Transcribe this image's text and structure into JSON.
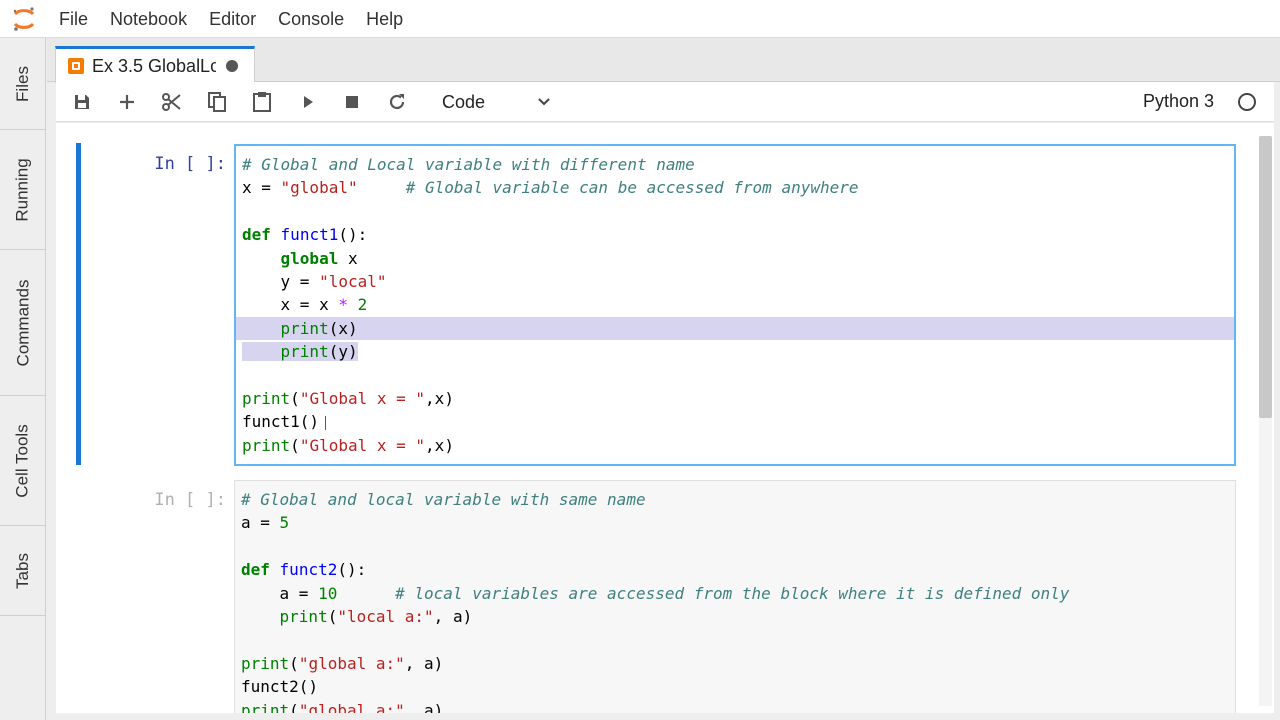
{
  "menu": {
    "items": [
      "File",
      "Notebook",
      "Editor",
      "Console",
      "Help"
    ]
  },
  "sidebar": {
    "tabs": [
      "Files",
      "Running",
      "Commands",
      "Cell Tools",
      "Tabs"
    ]
  },
  "document_tab": {
    "label": "Ex 3.5 GlobalLc"
  },
  "toolbar": {
    "cell_type": "Code",
    "kernel": "Python 3"
  },
  "cells": [
    {
      "prompt": "In [ ]:",
      "selected": true,
      "lines": [
        "# Global and Local variable with different name",
        "x = \"global\"     # Global variable can be accessed from anywhere",
        "",
        "def funct1():",
        "    global x",
        "    y = \"local\"",
        "    x = x * 2",
        "    print(x)",
        "    print(y)",
        "",
        "print(\"Global x = \",x)",
        "funct1()",
        "print(\"Global x = \",x)"
      ]
    },
    {
      "prompt": "In [ ]:",
      "selected": false,
      "lines": [
        "# Global and local variable with same name",
        "a = 5",
        "",
        "def funct2():",
        "    a = 10      # local variables are accessed from the block where it is defined only",
        "    print(\"local a:\", a)",
        "",
        "print(\"global a:\", a)",
        "funct2()",
        "print(\"global a:\", a)"
      ]
    }
  ],
  "colors": {
    "accent": "#1976d2",
    "selection": "#d7d4f0",
    "comment": "#408080",
    "string": "#ba2121",
    "keyword": "#008000",
    "function": "#0000ff"
  }
}
